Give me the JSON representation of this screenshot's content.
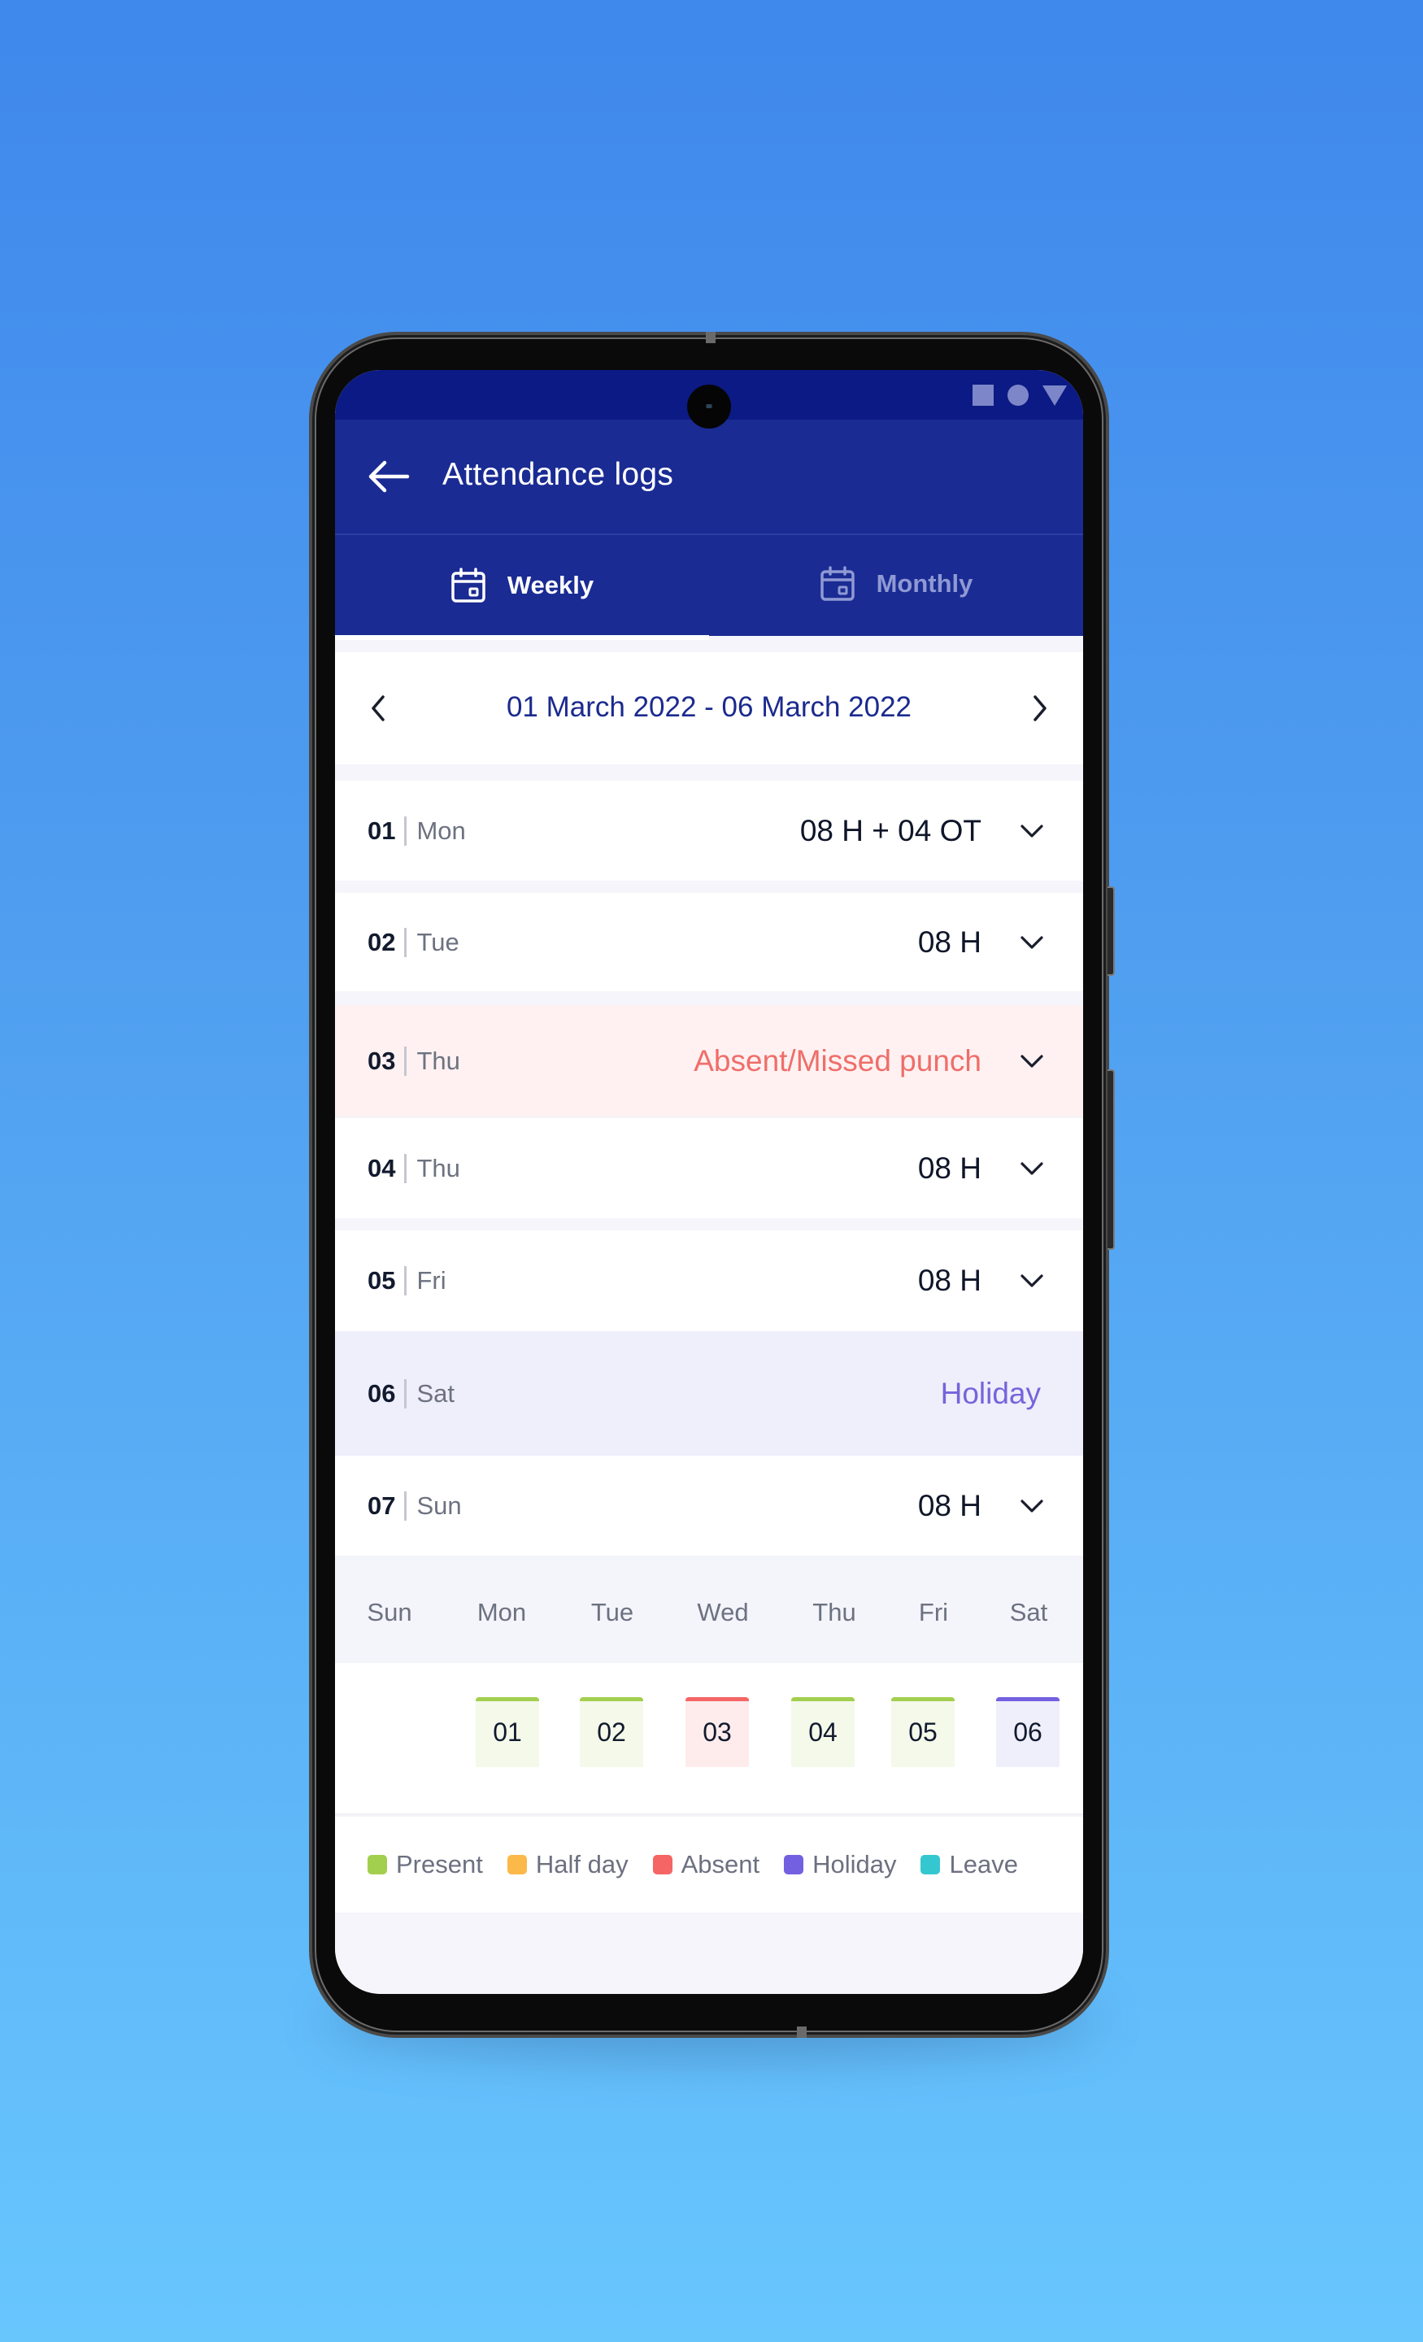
{
  "status_bar": {
    "icons": [
      "square-icon",
      "circle-icon",
      "triangle-icon"
    ]
  },
  "app_bar": {
    "back_icon": "arrow-left-icon",
    "title": "Attendance logs"
  },
  "tabs": [
    {
      "label": "Weekly",
      "icon": "calendar-icon",
      "active": true
    },
    {
      "label": "Monthly",
      "icon": "calendar-icon",
      "active": false
    }
  ],
  "date_nav": {
    "range": "01 March 2022 - 06 March 2022",
    "prev_icon": "chevron-left-icon",
    "next_icon": "chevron-right-icon"
  },
  "days": [
    {
      "num": "01",
      "day": "Mon",
      "value": "08 H + 04 OT",
      "status": "present",
      "expandable": true
    },
    {
      "num": "02",
      "day": "Tue",
      "value": "08 H",
      "status": "present",
      "expandable": true
    },
    {
      "num": "03",
      "day": "Thu",
      "value": "Absent/Missed punch",
      "status": "absent",
      "expandable": true
    },
    {
      "num": "04",
      "day": "Thu",
      "value": "08 H",
      "status": "present",
      "expandable": true
    },
    {
      "num": "05",
      "day": "Fri",
      "value": "08 H",
      "status": "present",
      "expandable": true
    },
    {
      "num": "06",
      "day": "Sat",
      "value": "Holiday",
      "status": "holiday",
      "expandable": false
    },
    {
      "num": "07",
      "day": "Sun",
      "value": "08 H",
      "status": "present",
      "expandable": true
    }
  ],
  "week_calendar": {
    "weekdays": [
      "Sun",
      "Mon",
      "Tue",
      "Wed",
      "Thu",
      "Fri",
      "Sat"
    ],
    "chips": [
      {
        "label": "01",
        "status": "present"
      },
      {
        "label": "02",
        "status": "present"
      },
      {
        "label": "03",
        "status": "absent"
      },
      {
        "label": "04",
        "status": "present"
      },
      {
        "label": "05",
        "status": "present"
      },
      {
        "label": "06",
        "status": "holiday"
      }
    ]
  },
  "legend": [
    {
      "label": "Present",
      "color": "#a3cf4f"
    },
    {
      "label": "Half day",
      "color": "#fbb94a"
    },
    {
      "label": "Absent",
      "color": "#f56565"
    },
    {
      "label": "Holiday",
      "color": "#7360e0"
    },
    {
      "label": "Leave",
      "color": "#35c7cf"
    }
  ],
  "colors": {
    "primary": "#1a2b93",
    "status_bar": "#0b1a84",
    "present_bar": "#a3cf4f",
    "present_bg": "#f4f9ea",
    "absent_bar": "#f56565",
    "absent_bg": "#fdeceb",
    "holiday_bar": "#7360e0",
    "holiday_bg": "#efeefb"
  }
}
